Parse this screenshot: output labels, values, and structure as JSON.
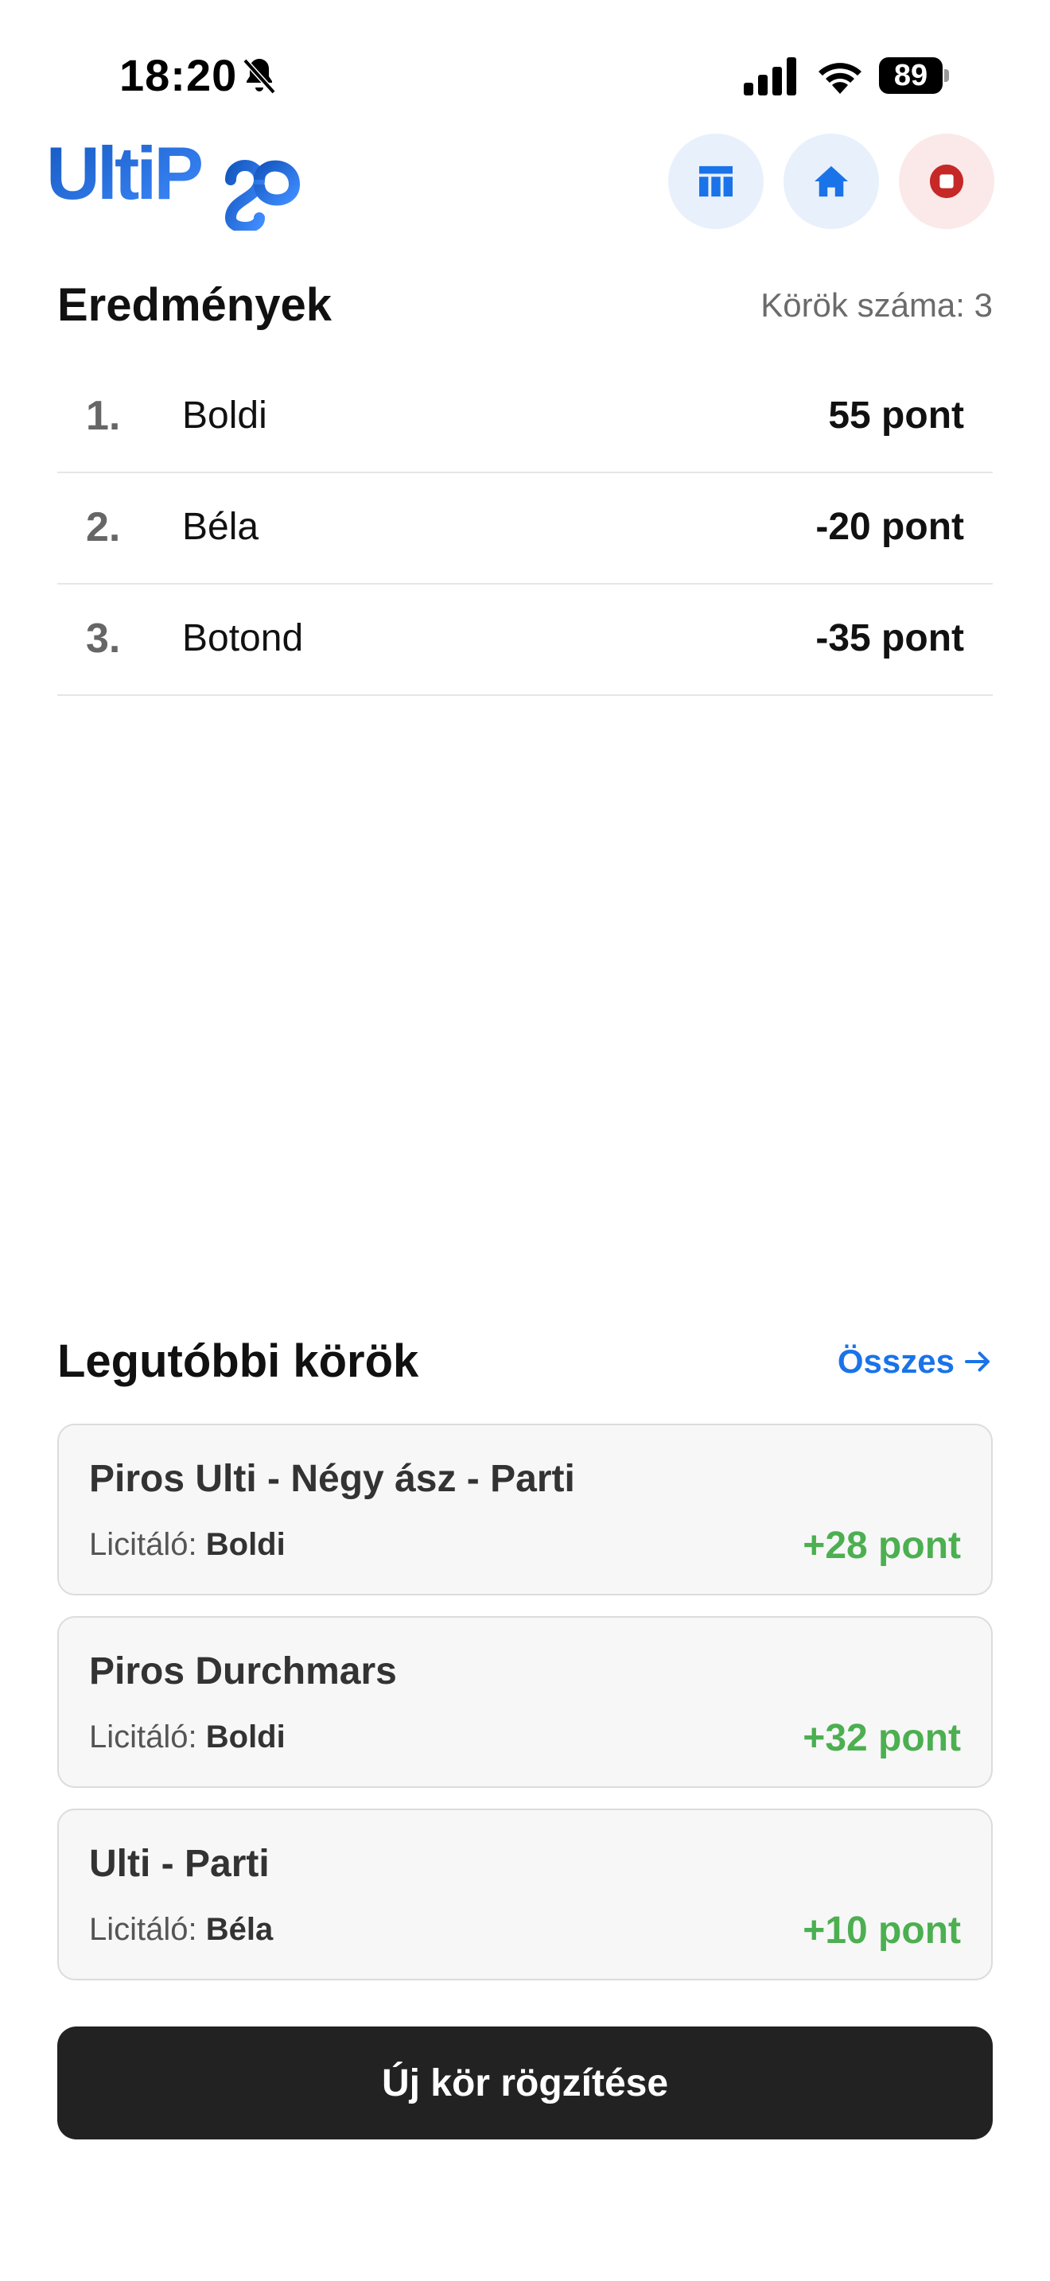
{
  "status_bar": {
    "time": "18:20",
    "battery": "89",
    "icons": [
      "bell-slash-icon",
      "signal-icon",
      "wifi-icon",
      "battery-icon"
    ]
  },
  "header": {
    "logo_text": "UltiPro",
    "buttons": [
      {
        "icon": "table-icon"
      },
      {
        "icon": "home-icon"
      },
      {
        "icon": "stop-icon"
      }
    ],
    "colors": {
      "accent": "#1a73e8",
      "stop": "#c62828",
      "logo_start": "#1565c0",
      "logo_end": "#3b8bff"
    }
  },
  "results": {
    "title": "Eredmények",
    "rounds_count": "Körök száma: 3",
    "rows": [
      {
        "rank": "1.",
        "name": "Boldi",
        "points": "55 pont"
      },
      {
        "rank": "2.",
        "name": "Béla",
        "points": "-20 pont"
      },
      {
        "rank": "3.",
        "name": "Botond",
        "points": "-35 pont"
      }
    ]
  },
  "recent": {
    "title": "Legutóbbi körök",
    "all_link": "Összes",
    "all_icon": "arrow-right-icon",
    "bidder_label": "Licitáló:",
    "rounds": [
      {
        "name": "Piros Ulti - Négy ász - Parti",
        "bidder": "Boldi",
        "points": "+28 pont"
      },
      {
        "name": "Piros Durchmars",
        "bidder": "Boldi",
        "points": "+32 pont"
      },
      {
        "name": "Ulti - Parti",
        "bidder": "Béla",
        "points": "+10 pont"
      }
    ],
    "points_color": "#4caf50"
  },
  "actions": {
    "new_round": "Új kör rögzítése"
  }
}
